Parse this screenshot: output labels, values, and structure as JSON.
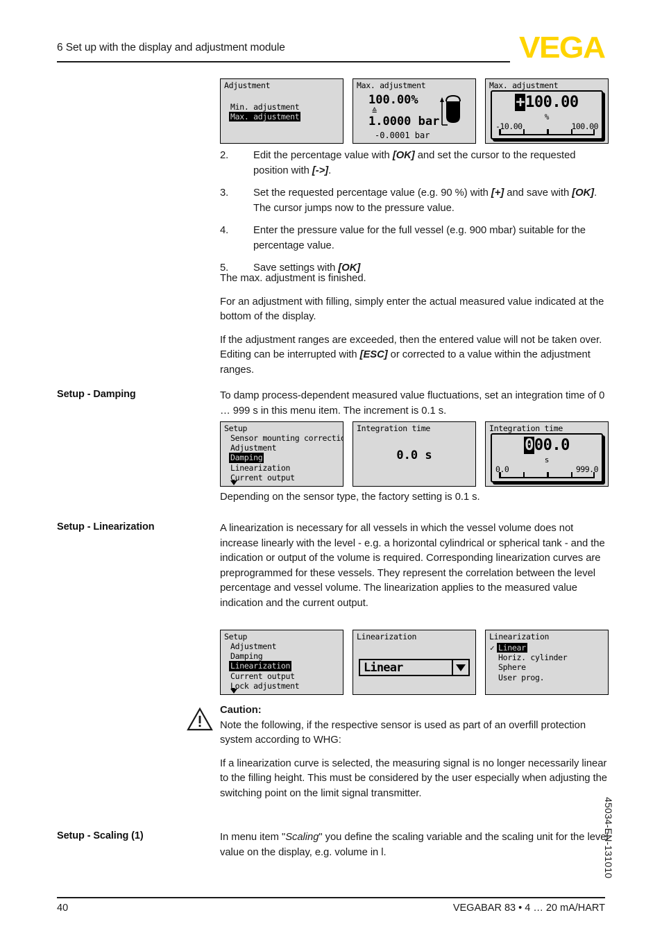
{
  "header": {
    "chapter_title": "6 Set up with the display and adjustment module",
    "logo_text": "VEGA",
    "logo_color": "#FFD400"
  },
  "modules_row_adjustment": [
    {
      "title": "Adjustment",
      "items": [
        {
          "label": "Min. adjustment",
          "selected": false
        },
        {
          "label": "Max. adjustment",
          "selected": true
        }
      ]
    },
    {
      "title": "Max. adjustment",
      "percent": "100.00%",
      "equiv_symbol": "≙",
      "pressure": "1.0000 bar",
      "measured": "-0.0001 bar",
      "icon": "full-vessel-icon"
    },
    {
      "title": "Max. adjustment",
      "cursor_digit": "+",
      "value_rest": "100.00",
      "unit": "%",
      "min": "-10.00",
      "max": "100.00"
    }
  ],
  "steps": [
    {
      "num": "2.",
      "parts": [
        {
          "t": "Edit the percentage value with ",
          "s": "n"
        },
        {
          "t": "[OK]",
          "s": "bi"
        },
        {
          "t": " and set the cursor to the requested position with ",
          "s": "n"
        },
        {
          "t": "[->]",
          "s": "bi"
        },
        {
          "t": ".",
          "s": "n"
        }
      ]
    },
    {
      "num": "3.",
      "parts": [
        {
          "t": "Set the requested percentage value (e.g. 90 %) with ",
          "s": "n"
        },
        {
          "t": "[+]",
          "s": "bi"
        },
        {
          "t": " and save with ",
          "s": "n"
        },
        {
          "t": "[OK]",
          "s": "bi"
        },
        {
          "t": ". The cursor jumps now to the pressure value.",
          "s": "n"
        }
      ]
    },
    {
      "num": "4.",
      "parts": [
        {
          "t": "Enter the pressure value for the full vessel (e.g. 900 mbar) suitable for the percentage value.",
          "s": "n"
        }
      ]
    },
    {
      "num": "5.",
      "parts": [
        {
          "t": "Save settings with ",
          "s": "n"
        },
        {
          "t": "[OK]",
          "s": "bi"
        }
      ]
    }
  ],
  "adjustment_paragraphs": {
    "p1": "The max. adjustment is finished.",
    "p2": "For an adjustment with filling, simply enter the actual measured value indicated at the bottom of the display.",
    "p3a": "If the adjustment ranges are exceeded, then the entered value will not be taken over. Editing can be interrupted with ",
    "p3_esc": "[ESC]",
    "p3b": " or corrected to a value within the adjustment ranges."
  },
  "damping": {
    "marginal": "Setup - Damping",
    "intro": "To damp process-dependent measured value fluctuations, set an integration time of 0 … 999 s in this menu item. The increment is 0.1 s.",
    "after": "Depending on the sensor type, the factory setting is 0.1 s.",
    "modules": [
      {
        "title": "Setup",
        "items": [
          {
            "label": "Sensor mounting correction",
            "selected": false
          },
          {
            "label": "Adjustment",
            "selected": false
          },
          {
            "label": "Damping",
            "selected": true
          },
          {
            "label": "Linearization",
            "selected": false
          },
          {
            "label": "Current output",
            "selected": false
          }
        ],
        "more_arrow": "chevron-down-icon"
      },
      {
        "title": "Integration time",
        "value": "0.0 s"
      },
      {
        "title": "Integration time",
        "cursor_digit": "0",
        "value_rest": "00.0",
        "unit": "s",
        "min": "0.0",
        "max": "999.0"
      }
    ]
  },
  "linearization": {
    "marginal": "Setup - Linearization",
    "intro": "A linearization is necessary for all vessels in which the vessel volume does not increase linearly with the level - e.g. a horizontal cylindrical or spherical tank - and the indication or output of the volume is required. Corresponding linearization curves are preprogrammed for these vessels. They represent the correlation between the level percentage and vessel volume. The linearization applies to the measured value indication and the current output.",
    "modules": [
      {
        "title": "Setup",
        "items": [
          {
            "label": "Adjustment",
            "selected": false
          },
          {
            "label": "Damping",
            "selected": false
          },
          {
            "label": "Linearization",
            "selected": true
          },
          {
            "label": "Current output",
            "selected": false
          },
          {
            "label": "Lock adjustment",
            "selected": false
          }
        ],
        "more_arrow": "chevron-down-icon"
      },
      {
        "title": "Linearization",
        "selected_option": "Linear",
        "dropdown_icon": "chevron-down-icon"
      },
      {
        "title": "Linearization",
        "options": [
          {
            "label": "Linear",
            "selected": true,
            "checked": true
          },
          {
            "label": "Horiz. cylinder",
            "selected": false,
            "checked": false
          },
          {
            "label": "Sphere",
            "selected": false,
            "checked": false
          },
          {
            "label": "User prog.",
            "selected": false,
            "checked": false
          }
        ]
      }
    ]
  },
  "caution": {
    "icon": "warning-triangle-icon",
    "heading": "Caution:",
    "lead": "Note the following, if the respective sensor is used as part of an overfill protection system according to WHG:",
    "body": "If a linearization curve is selected, the measuring signal is no longer necessarily linear to the filling height. This must be considered by the user especially when adjusting the switching point on the limit signal transmitter."
  },
  "scaling": {
    "marginal": "Setup - Scaling (1)",
    "p_a": "In menu item \"",
    "p_italic": "Scaling",
    "p_b": "\" you define the scaling variable and the scaling unit for the level value on the display, e.g. volume in l."
  },
  "footer": {
    "page_number": "40",
    "product": "VEGABAR 83 • 4 … 20 mA/HART",
    "doc_code": "45034-EN-131010"
  }
}
